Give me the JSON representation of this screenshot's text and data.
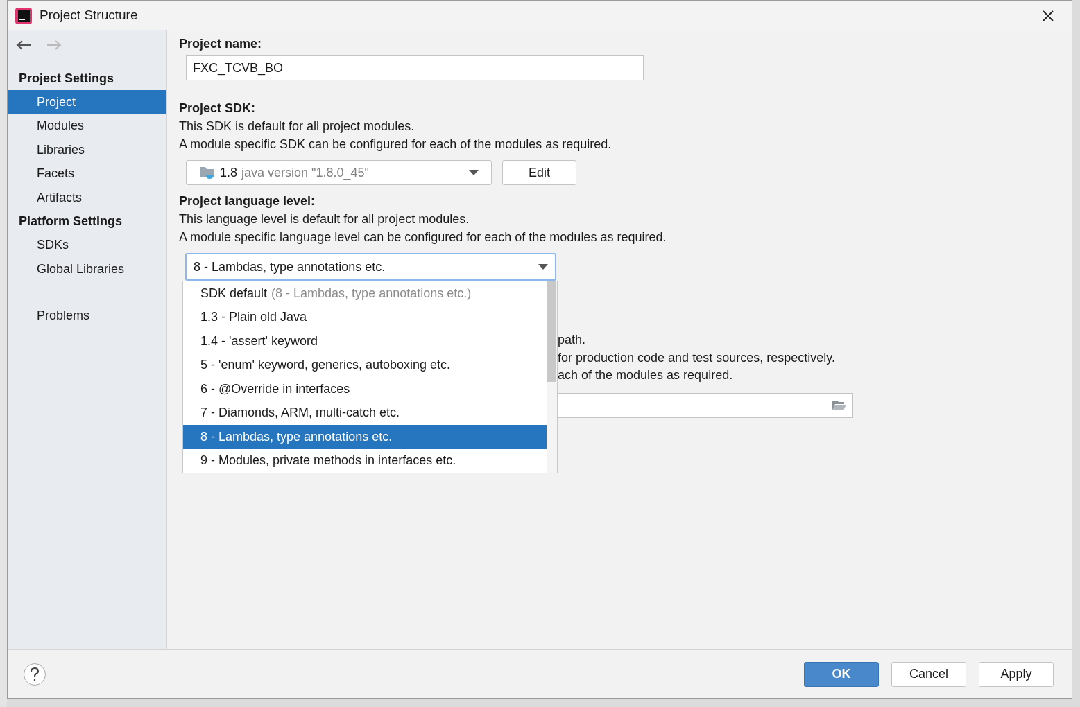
{
  "window": {
    "title": "Project Structure"
  },
  "nav": {
    "back_enabled": true,
    "forward_enabled": false
  },
  "sidebar": {
    "sections": [
      {
        "title": "Project Settings",
        "items": [
          {
            "label": "Project",
            "selected": true
          },
          {
            "label": "Modules",
            "selected": false
          },
          {
            "label": "Libraries",
            "selected": false
          },
          {
            "label": "Facets",
            "selected": false
          },
          {
            "label": "Artifacts",
            "selected": false
          }
        ]
      },
      {
        "title": "Platform Settings",
        "items": [
          {
            "label": "SDKs",
            "selected": false
          },
          {
            "label": "Global Libraries",
            "selected": false
          }
        ]
      }
    ],
    "extra_items": [
      {
        "label": "Problems",
        "selected": false
      }
    ]
  },
  "project_name": {
    "label": "Project name:",
    "value": "FXC_TCVB_BO"
  },
  "project_sdk": {
    "label": "Project SDK:",
    "description": [
      "This SDK is default for all project modules.",
      "A module specific SDK can be configured for each of the modules as required."
    ],
    "dropdown": {
      "version": "1.8",
      "detail": "java version \"1.8.0_45\""
    },
    "edit_button": "Edit"
  },
  "language_level": {
    "label": "Project language level:",
    "description": [
      "This language level is default for all project modules.",
      "A module specific language level can be configured for each of the modules as required."
    ],
    "dropdown": {
      "value": "8 - Lambdas, type annotations etc.",
      "focused": true
    },
    "options": [
      {
        "label": "SDK default",
        "detail": "(8 - Lambdas, type annotations etc.)",
        "selected": false
      },
      {
        "label": "1.3 - Plain old Java",
        "selected": false
      },
      {
        "label": "1.4 - 'assert' keyword",
        "selected": false
      },
      {
        "label": "5 - 'enum' keyword, generics, autoboxing etc.",
        "selected": false
      },
      {
        "label": "6 - @Override in interfaces",
        "selected": false
      },
      {
        "label": "7 - Diamonds, ARM, multi-catch etc.",
        "selected": false
      },
      {
        "label": "8 - Lambdas, type annotations etc.",
        "selected": true
      },
      {
        "label": "9 - Modules, private methods in interfaces etc.",
        "selected": false
      }
    ]
  },
  "covered_section": {
    "lines": [
      {
        "text": "path."
      },
      {
        "text": "for production code and test sources, respectively."
      },
      {
        "text": "ach of the modules as required."
      }
    ]
  },
  "footer": {
    "buttons": [
      {
        "label": "OK",
        "kind": "primary"
      },
      {
        "label": "Cancel",
        "kind": "normal"
      },
      {
        "label": "Apply",
        "kind": "normal"
      }
    ]
  }
}
